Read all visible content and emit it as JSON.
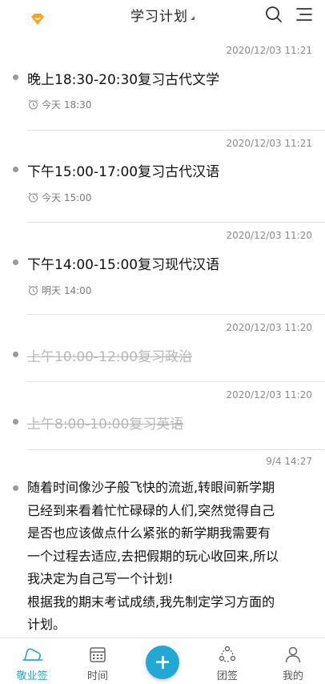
{
  "header": {
    "title": "学习计划",
    "logo_icon": "diamond-heart-icon",
    "search_icon": "search-icon",
    "menu_icon": "menu-icon",
    "accent": "#f5a623"
  },
  "items": [
    {
      "timestamp": "2020/12/03 11:21",
      "title": "晚上18:30-20:30复习古代文学",
      "remind": "今天 18:30",
      "done": false
    },
    {
      "timestamp": "2020/12/03 11:21",
      "title": "下午15:00-17:00复习古代汉语",
      "remind": "今天 15:00",
      "done": false
    },
    {
      "timestamp": "2020/12/03 11:20",
      "title": "下午14:00-15:00复习现代汉语",
      "remind": "明天 14:00",
      "done": false
    },
    {
      "timestamp": "2020/12/03 11:20",
      "title": "上午10:00-12:00复习政治",
      "remind": "",
      "done": true
    },
    {
      "timestamp": "2020/12/03 11:20",
      "title": "上午8:00-10:00复习英语",
      "remind": "",
      "done": true
    }
  ],
  "note": {
    "timestamp": "9/4 14:27",
    "lines": [
      "随着时间像沙子般飞快的流逝,转眼间新学期",
      "已经到来看着忙忙碌碌的人们,突然觉得自己",
      "是否也应该做点什么紧张的新学期我需要有",
      "一个过程去适应,去把假期的玩心收回来,所以",
      "我决定为自己写一个计划!",
      "根据我的期末考试成绩,我先制定学习方面的",
      "计划。"
    ]
  },
  "tabbar": {
    "tabs": [
      {
        "label": "敬业签",
        "icon": "cloud-icon",
        "active": true
      },
      {
        "label": "时间",
        "icon": "calendar-icon",
        "active": false
      },
      {
        "label": "团签",
        "icon": "team-icon",
        "active": false
      },
      {
        "label": "我的",
        "icon": "user-icon",
        "active": false
      }
    ],
    "add_icon": "plus-icon",
    "active_color": "#2aa7c6"
  }
}
